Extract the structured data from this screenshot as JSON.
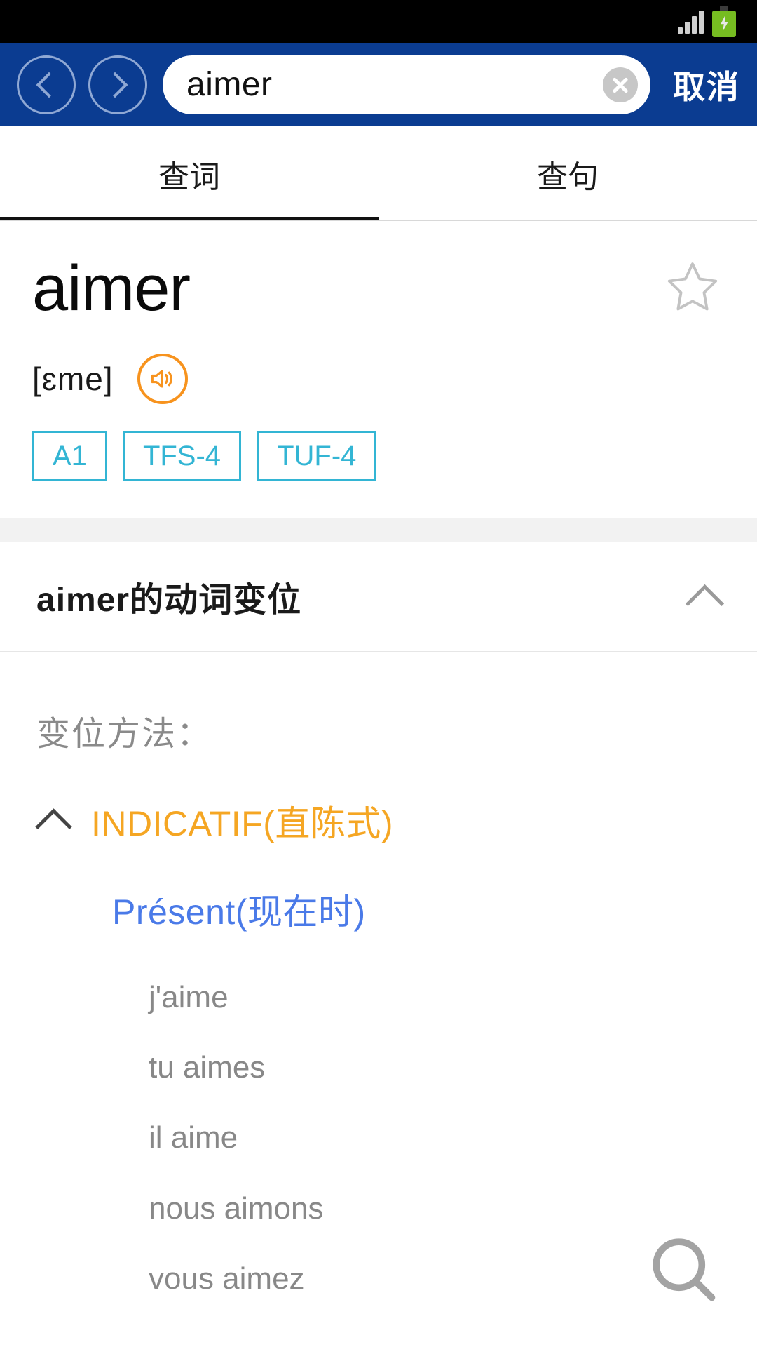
{
  "status_bar": {
    "signal_icon": "signal-bars-icon",
    "battery_icon": "battery-charging-icon"
  },
  "search_bar": {
    "back_icon": "chevron-left-circle-icon",
    "forward_icon": "chevron-right-circle-icon",
    "query_value": "aimer",
    "query_placeholder": "",
    "clear_icon": "close-circle-icon",
    "cancel_label": "取消",
    "background_color": "#0b3c91"
  },
  "tabs": [
    {
      "label": "查词",
      "active": true
    },
    {
      "label": "查句",
      "active": false
    }
  ],
  "entry": {
    "word": "aimer",
    "favorite_icon": "star-outline-icon",
    "phonetic": "[ɛme]",
    "audio_icon": "speaker-icon",
    "audio_color": "#f7931e",
    "tags": [
      "A1",
      "TFS-4",
      "TUF-4"
    ],
    "tag_color": "#33b5d4"
  },
  "conjugation_section": {
    "title": "aimer的动词变位",
    "collapse_icon": "chevron-up-icon",
    "method_label": "变位方法：",
    "mood": {
      "toggle_icon": "chevron-up-icon",
      "label": "INDICATIF(直陈式)",
      "color": "#f5a623"
    },
    "tense": {
      "label": "Présent(现在时)",
      "color": "#4a7ae8"
    },
    "forms": [
      "j'aime",
      "tu aimes",
      "il aime",
      "nous aimons",
      "vous aimez"
    ]
  },
  "fab": {
    "icon": "search-icon",
    "color": "#9e9e9e"
  }
}
